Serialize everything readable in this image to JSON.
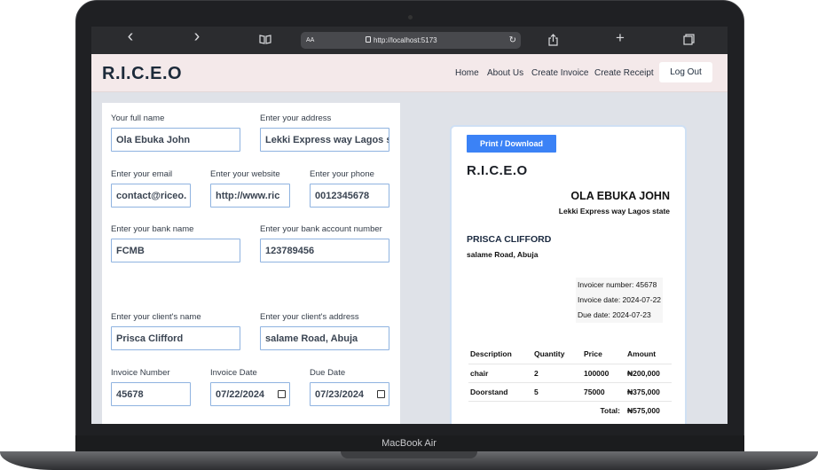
{
  "device": {
    "label": "MacBook Air"
  },
  "browser": {
    "text_size_label": "AA",
    "url": "http://localhost:5173",
    "back_glyph": "‹",
    "forward_glyph": "›",
    "reload_glyph": "↻",
    "bookmarks_glyph": "📖",
    "share_glyph": "⇪",
    "new_tab_glyph": "+",
    "tabs_glyph": "⧉"
  },
  "header": {
    "logo": "R.I.C.E.O",
    "nav": [
      "Home",
      "About Us",
      "Create Invoice",
      "Create Receipt"
    ],
    "logout": "Log Out"
  },
  "form": {
    "full_name": {
      "label": "Your full name",
      "value": "Ola Ebuka John"
    },
    "address": {
      "label": "Enter your address",
      "value": "Lekki Express way Lagos s"
    },
    "email": {
      "label": "Enter your email",
      "value": "contact@riceo."
    },
    "website": {
      "label": "Enter your website",
      "value": "http://www.ric"
    },
    "phone": {
      "label": "Enter your phone",
      "value": "0012345678"
    },
    "bank_name": {
      "label": "Enter your bank name",
      "value": "FCMB"
    },
    "account_number": {
      "label": "Enter your bank account number",
      "value": "123789456"
    },
    "client_name": {
      "label": "Enter your client's name",
      "value": "Prisca Clifford"
    },
    "client_address": {
      "label": "Enter your client's address",
      "value": "salame Road, Abuja"
    },
    "invoice_number": {
      "label": "Invoice Number",
      "value": "45678"
    },
    "invoice_date": {
      "label": "Invoice Date",
      "value": "07/22/2024"
    },
    "due_date": {
      "label": "Due Date",
      "value": "07/23/2024"
    }
  },
  "invoice": {
    "print_button": "Print / Download",
    "logo": "R.I.C.E.O",
    "sender_name": "OLA EBUKA JOHN",
    "sender_address": "Lekki Express way Lagos state",
    "client_name": "PRISCA CLIFFORD",
    "client_address": "salame Road, Abuja",
    "invoicer_number": "Invoicer number: 45678",
    "invoice_date": "Invoice date: 2024-07-22",
    "due_date": "Due date: 2024-07-23",
    "table": {
      "headers": [
        "Description",
        "Quantity",
        "Price",
        "Amount"
      ],
      "rows": [
        [
          "chair",
          "2",
          "100000",
          "₦200,000"
        ],
        [
          "Doorstand",
          "5",
          "75000",
          "₦375,000"
        ]
      ],
      "total_label": "Total:",
      "total_value": "₦575,000"
    }
  },
  "colors": {
    "accent": "#3b82f6",
    "header_bg": "#f4e9ea",
    "input_border": "#8fb3e0",
    "page_bg": "#dfe2e8"
  }
}
